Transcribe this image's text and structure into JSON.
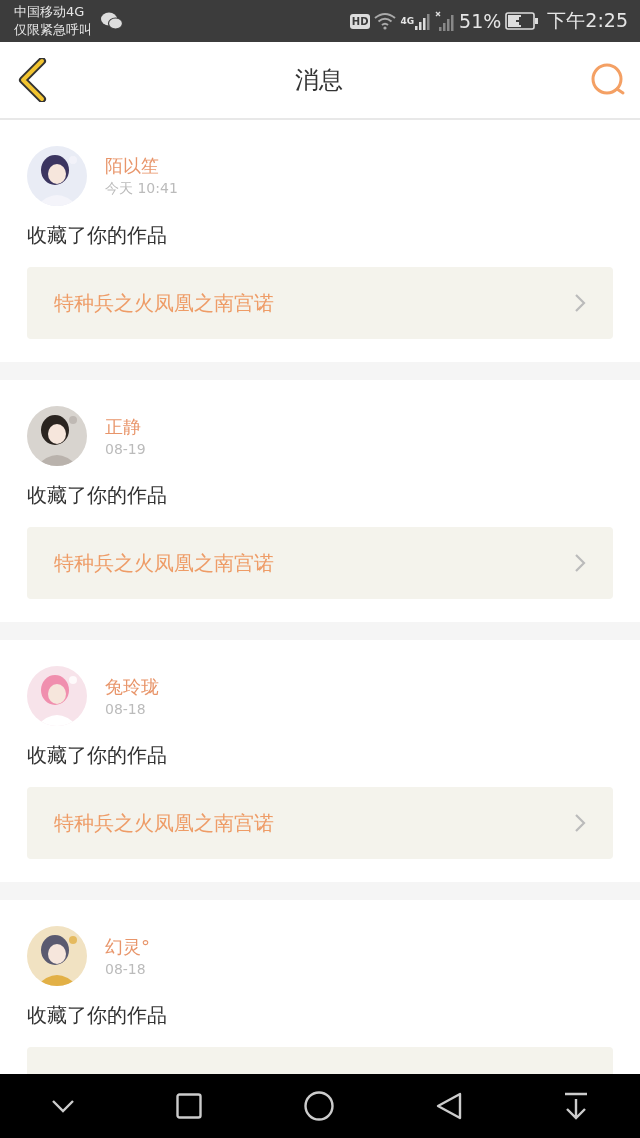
{
  "status_bar": {
    "carrier": "中国移动4G",
    "notice": "仅限紧急呼叫",
    "hd": "HD",
    "network": "4G",
    "battery": "51%",
    "time": "下午2:25"
  },
  "header": {
    "title": "消息"
  },
  "messages": [
    {
      "name": "陌以笙",
      "time": "今天 10:41",
      "action": "收藏了你的作品",
      "work": "特种兵之火凤凰之南宫诺"
    },
    {
      "name": "正静",
      "time": "08-19",
      "action": "收藏了你的作品",
      "work": "特种兵之火凤凰之南宫诺"
    },
    {
      "name": "兔玲珑",
      "time": "08-18",
      "action": "收藏了你的作品",
      "work": "特种兵之火凤凰之南宫诺"
    },
    {
      "name": "幻灵°",
      "time": "08-18",
      "action": "收藏了你的作品"
    }
  ]
}
